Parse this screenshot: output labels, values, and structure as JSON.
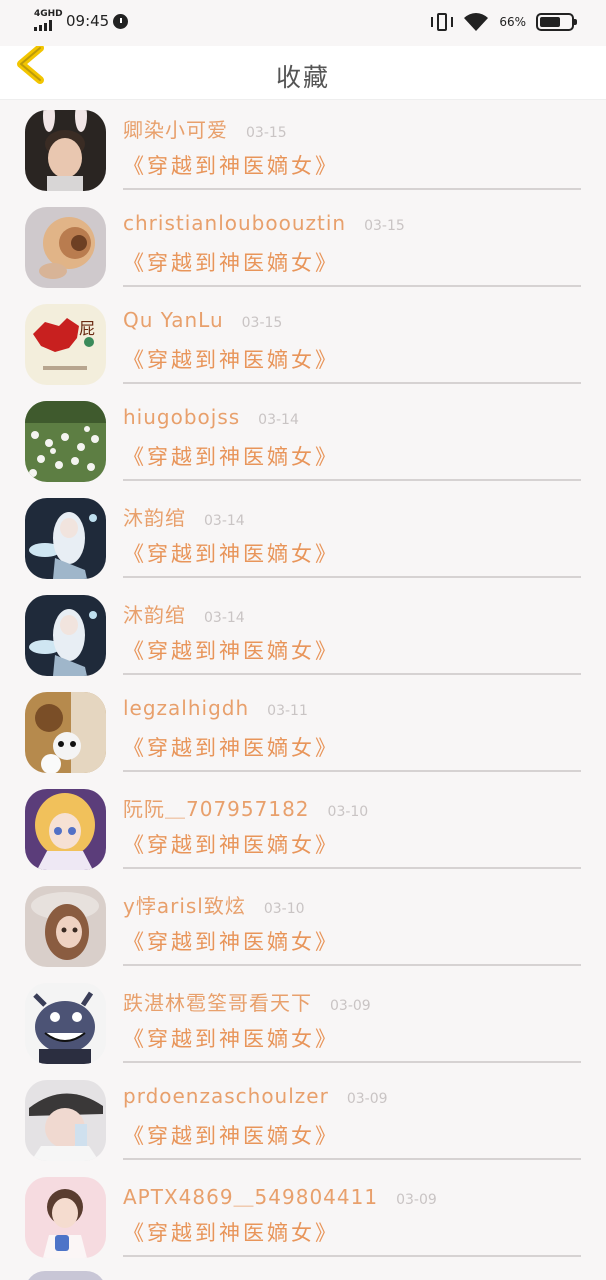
{
  "status_bar": {
    "network": "4GHD",
    "time": "09:45",
    "battery_percent": "66%",
    "battery_level": 0.66
  },
  "header": {
    "title": "收藏",
    "back_icon": "chevron-left-icon",
    "accent_color": "#f2c500"
  },
  "colors": {
    "name": "#e8a06c",
    "book": "#e8955a",
    "date": "#c9c4c4"
  },
  "items": [
    {
      "name": "卿染小可爱",
      "date": "03-15",
      "book": "《穿越到神医嫡女》",
      "avatar": "avatar-boy-bunny-ears"
    },
    {
      "name": "christianlouboouztin",
      "date": "03-15",
      "book": "《穿越到神医嫡女》",
      "avatar": "avatar-nautilus-shell"
    },
    {
      "name": "Qu YanLu",
      "date": "03-15",
      "book": "《穿越到神医嫡女》",
      "avatar": "avatar-china-map"
    },
    {
      "name": "hiugobojss",
      "date": "03-14",
      "book": "《穿越到神医嫡女》",
      "avatar": "avatar-flower-field"
    },
    {
      "name": "沐韵绾",
      "date": "03-14",
      "book": "《穿越到神医嫡女》",
      "avatar": "avatar-anime-girl"
    },
    {
      "name": "沐韵绾",
      "date": "03-14",
      "book": "《穿越到神医嫡女》",
      "avatar": "avatar-anime-girl"
    },
    {
      "name": "legzalhigdh",
      "date": "03-11",
      "book": "《穿越到神医嫡女》",
      "avatar": "avatar-cartoon-bears"
    },
    {
      "name": "阮阮＿707957182",
      "date": "03-10",
      "book": "《穿越到神医嫡女》",
      "avatar": "avatar-anime-blonde"
    },
    {
      "name": "y悖arisl致炫",
      "date": "03-10",
      "book": "《穿越到神医嫡女》",
      "avatar": "avatar-doll"
    },
    {
      "name": "跌湛林雹筌哥看天下",
      "date": "03-09",
      "book": "《穿越到神医嫡女》",
      "avatar": "avatar-cartoon-monster"
    },
    {
      "name": "prdoenzaschoulzer",
      "date": "03-09",
      "book": "《穿越到神医嫡女》",
      "avatar": "avatar-girl-cap"
    },
    {
      "name": "APTX4869＿549804411",
      "date": "03-09",
      "book": "《穿越到神医嫡女》",
      "avatar": "avatar-girl-pink"
    }
  ]
}
